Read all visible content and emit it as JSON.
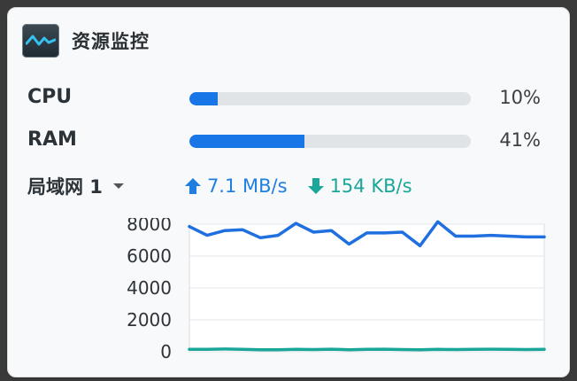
{
  "widget": {
    "title": "资源监控"
  },
  "cpu": {
    "label": "CPU",
    "percent": 10,
    "percent_text": "10%"
  },
  "ram": {
    "label": "RAM",
    "percent": 41,
    "percent_text": "41%"
  },
  "network": {
    "interface": "局域网 1",
    "upload": "7.1 MB/s",
    "download": "154 KB/s"
  },
  "colors": {
    "bar": "#1876e6",
    "upload": "#1f7fe0",
    "download": "#1aa79a"
  },
  "chart_data": {
    "type": "line",
    "ylim": [
      0,
      8000
    ],
    "yticks": [
      "8000",
      "6000",
      "4000",
      "2000",
      "0"
    ],
    "ytick_values": [
      8000,
      6000,
      4000,
      2000,
      0
    ],
    "x": [
      1,
      2,
      3,
      4,
      5,
      6,
      7,
      8,
      9,
      10,
      11,
      12,
      13,
      14,
      15,
      16,
      17,
      18,
      19,
      20,
      21
    ],
    "series": [
      {
        "color": "#1f6fe0",
        "values": [
          7850,
          7300,
          7600,
          7650,
          7150,
          7300,
          8050,
          7500,
          7600,
          6750,
          7450,
          7450,
          7500,
          6650,
          8150,
          7250,
          7250,
          7300,
          7250,
          7200,
          7200
        ]
      },
      {
        "color": "#1aa79a",
        "values": [
          154,
          154,
          170,
          150,
          120,
          130,
          150,
          140,
          160,
          130,
          150,
          160,
          140,
          130,
          150,
          140,
          150,
          160,
          150,
          140,
          154
        ]
      }
    ]
  }
}
